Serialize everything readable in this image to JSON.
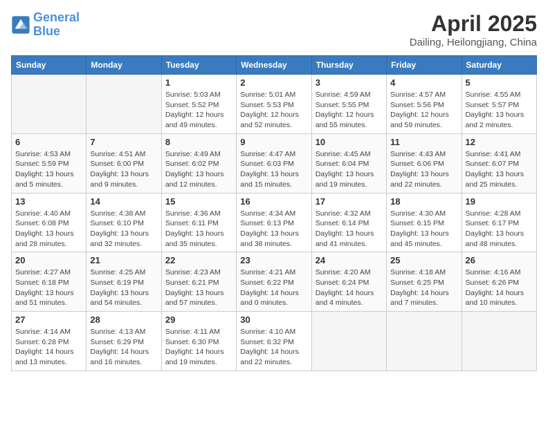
{
  "header": {
    "logo_line1": "General",
    "logo_line2": "Blue",
    "month_title": "April 2025",
    "subtitle": "Dailing, Heilongjiang, China"
  },
  "days_of_week": [
    "Sunday",
    "Monday",
    "Tuesday",
    "Wednesday",
    "Thursday",
    "Friday",
    "Saturday"
  ],
  "weeks": [
    [
      {
        "day": "",
        "info": ""
      },
      {
        "day": "",
        "info": ""
      },
      {
        "day": "1",
        "info": "Sunrise: 5:03 AM\nSunset: 5:52 PM\nDaylight: 12 hours\nand 49 minutes."
      },
      {
        "day": "2",
        "info": "Sunrise: 5:01 AM\nSunset: 5:53 PM\nDaylight: 12 hours\nand 52 minutes."
      },
      {
        "day": "3",
        "info": "Sunrise: 4:59 AM\nSunset: 5:55 PM\nDaylight: 12 hours\nand 55 minutes."
      },
      {
        "day": "4",
        "info": "Sunrise: 4:57 AM\nSunset: 5:56 PM\nDaylight: 12 hours\nand 59 minutes."
      },
      {
        "day": "5",
        "info": "Sunrise: 4:55 AM\nSunset: 5:57 PM\nDaylight: 13 hours\nand 2 minutes."
      }
    ],
    [
      {
        "day": "6",
        "info": "Sunrise: 4:53 AM\nSunset: 5:59 PM\nDaylight: 13 hours\nand 5 minutes."
      },
      {
        "day": "7",
        "info": "Sunrise: 4:51 AM\nSunset: 6:00 PM\nDaylight: 13 hours\nand 9 minutes."
      },
      {
        "day": "8",
        "info": "Sunrise: 4:49 AM\nSunset: 6:02 PM\nDaylight: 13 hours\nand 12 minutes."
      },
      {
        "day": "9",
        "info": "Sunrise: 4:47 AM\nSunset: 6:03 PM\nDaylight: 13 hours\nand 15 minutes."
      },
      {
        "day": "10",
        "info": "Sunrise: 4:45 AM\nSunset: 6:04 PM\nDaylight: 13 hours\nand 19 minutes."
      },
      {
        "day": "11",
        "info": "Sunrise: 4:43 AM\nSunset: 6:06 PM\nDaylight: 13 hours\nand 22 minutes."
      },
      {
        "day": "12",
        "info": "Sunrise: 4:41 AM\nSunset: 6:07 PM\nDaylight: 13 hours\nand 25 minutes."
      }
    ],
    [
      {
        "day": "13",
        "info": "Sunrise: 4:40 AM\nSunset: 6:08 PM\nDaylight: 13 hours\nand 28 minutes."
      },
      {
        "day": "14",
        "info": "Sunrise: 4:38 AM\nSunset: 6:10 PM\nDaylight: 13 hours\nand 32 minutes."
      },
      {
        "day": "15",
        "info": "Sunrise: 4:36 AM\nSunset: 6:11 PM\nDaylight: 13 hours\nand 35 minutes."
      },
      {
        "day": "16",
        "info": "Sunrise: 4:34 AM\nSunset: 6:13 PM\nDaylight: 13 hours\nand 38 minutes."
      },
      {
        "day": "17",
        "info": "Sunrise: 4:32 AM\nSunset: 6:14 PM\nDaylight: 13 hours\nand 41 minutes."
      },
      {
        "day": "18",
        "info": "Sunrise: 4:30 AM\nSunset: 6:15 PM\nDaylight: 13 hours\nand 45 minutes."
      },
      {
        "day": "19",
        "info": "Sunrise: 4:28 AM\nSunset: 6:17 PM\nDaylight: 13 hours\nand 48 minutes."
      }
    ],
    [
      {
        "day": "20",
        "info": "Sunrise: 4:27 AM\nSunset: 6:18 PM\nDaylight: 13 hours\nand 51 minutes."
      },
      {
        "day": "21",
        "info": "Sunrise: 4:25 AM\nSunset: 6:19 PM\nDaylight: 13 hours\nand 54 minutes."
      },
      {
        "day": "22",
        "info": "Sunrise: 4:23 AM\nSunset: 6:21 PM\nDaylight: 13 hours\nand 57 minutes."
      },
      {
        "day": "23",
        "info": "Sunrise: 4:21 AM\nSunset: 6:22 PM\nDaylight: 14 hours\nand 0 minutes."
      },
      {
        "day": "24",
        "info": "Sunrise: 4:20 AM\nSunset: 6:24 PM\nDaylight: 14 hours\nand 4 minutes."
      },
      {
        "day": "25",
        "info": "Sunrise: 4:18 AM\nSunset: 6:25 PM\nDaylight: 14 hours\nand 7 minutes."
      },
      {
        "day": "26",
        "info": "Sunrise: 4:16 AM\nSunset: 6:26 PM\nDaylight: 14 hours\nand 10 minutes."
      }
    ],
    [
      {
        "day": "27",
        "info": "Sunrise: 4:14 AM\nSunset: 6:28 PM\nDaylight: 14 hours\nand 13 minutes."
      },
      {
        "day": "28",
        "info": "Sunrise: 4:13 AM\nSunset: 6:29 PM\nDaylight: 14 hours\nand 16 minutes."
      },
      {
        "day": "29",
        "info": "Sunrise: 4:11 AM\nSunset: 6:30 PM\nDaylight: 14 hours\nand 19 minutes."
      },
      {
        "day": "30",
        "info": "Sunrise: 4:10 AM\nSunset: 6:32 PM\nDaylight: 14 hours\nand 22 minutes."
      },
      {
        "day": "",
        "info": ""
      },
      {
        "day": "",
        "info": ""
      },
      {
        "day": "",
        "info": ""
      }
    ]
  ]
}
